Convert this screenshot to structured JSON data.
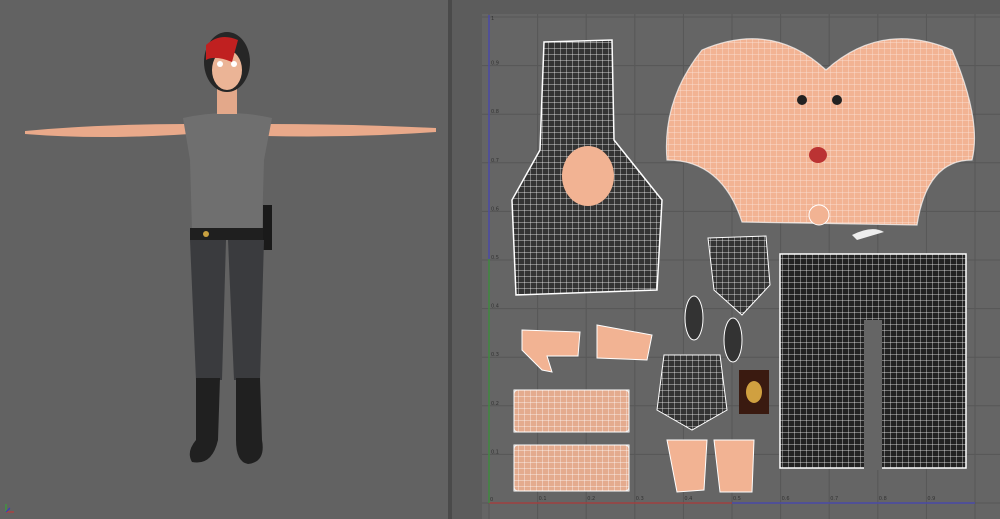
{
  "viewport": {
    "name": "perspective-viewport"
  },
  "uv_editor": {
    "name": "uv-texture-editor",
    "u_ticks": [
      "0.1",
      "0.2",
      "0.3",
      "0.4",
      "0.5",
      "0.6",
      "0.7",
      "0.8",
      "0.9"
    ],
    "v_ticks": [
      "0.1",
      "0.2",
      "0.3",
      "0.4",
      "0.5",
      "0.6",
      "0.7",
      "0.8",
      "0.9"
    ],
    "origin_label": "0",
    "max_label": "1"
  },
  "colors": {
    "skin": "#f2b393",
    "u_axis": "#a04040",
    "v_axis_low": "#3f8a3f",
    "v_axis_high": "#4a4aa8",
    "wire": "#ffffff"
  }
}
